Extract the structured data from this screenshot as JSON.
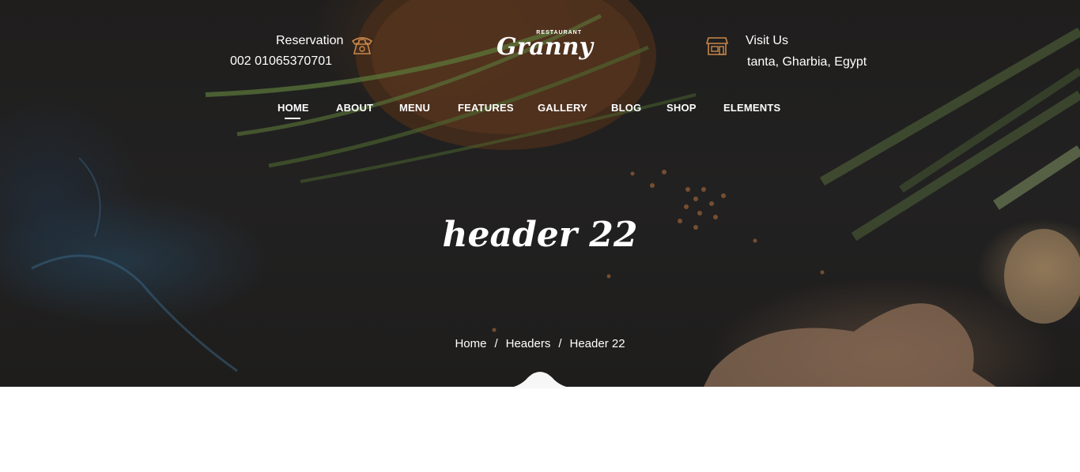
{
  "header": {
    "reservation_label": "Reservation",
    "reservation_phone": "002 01065370701",
    "visit_label": "Visit Us",
    "visit_address": "tanta, Gharbia, Egypt",
    "logo_tag": "RESTAURANT",
    "logo_name": "Granny"
  },
  "nav": {
    "items": [
      {
        "label": "HOME",
        "active": true
      },
      {
        "label": "ABOUT"
      },
      {
        "label": "MENU"
      },
      {
        "label": "FEATURES"
      },
      {
        "label": "GALLERY"
      },
      {
        "label": "BLOG"
      },
      {
        "label": "SHOP"
      },
      {
        "label": "ELEMENTS"
      }
    ]
  },
  "hero": {
    "title": "header 22"
  },
  "breadcrumb": {
    "items": [
      "Home",
      "Headers",
      "Header 22"
    ],
    "separator": "/"
  },
  "icons": {
    "phone": "phone-icon",
    "store": "store-icon"
  },
  "colors": {
    "accent": "#c8874a",
    "text": "#ffffff",
    "background_dark": "#1f1e1d"
  }
}
